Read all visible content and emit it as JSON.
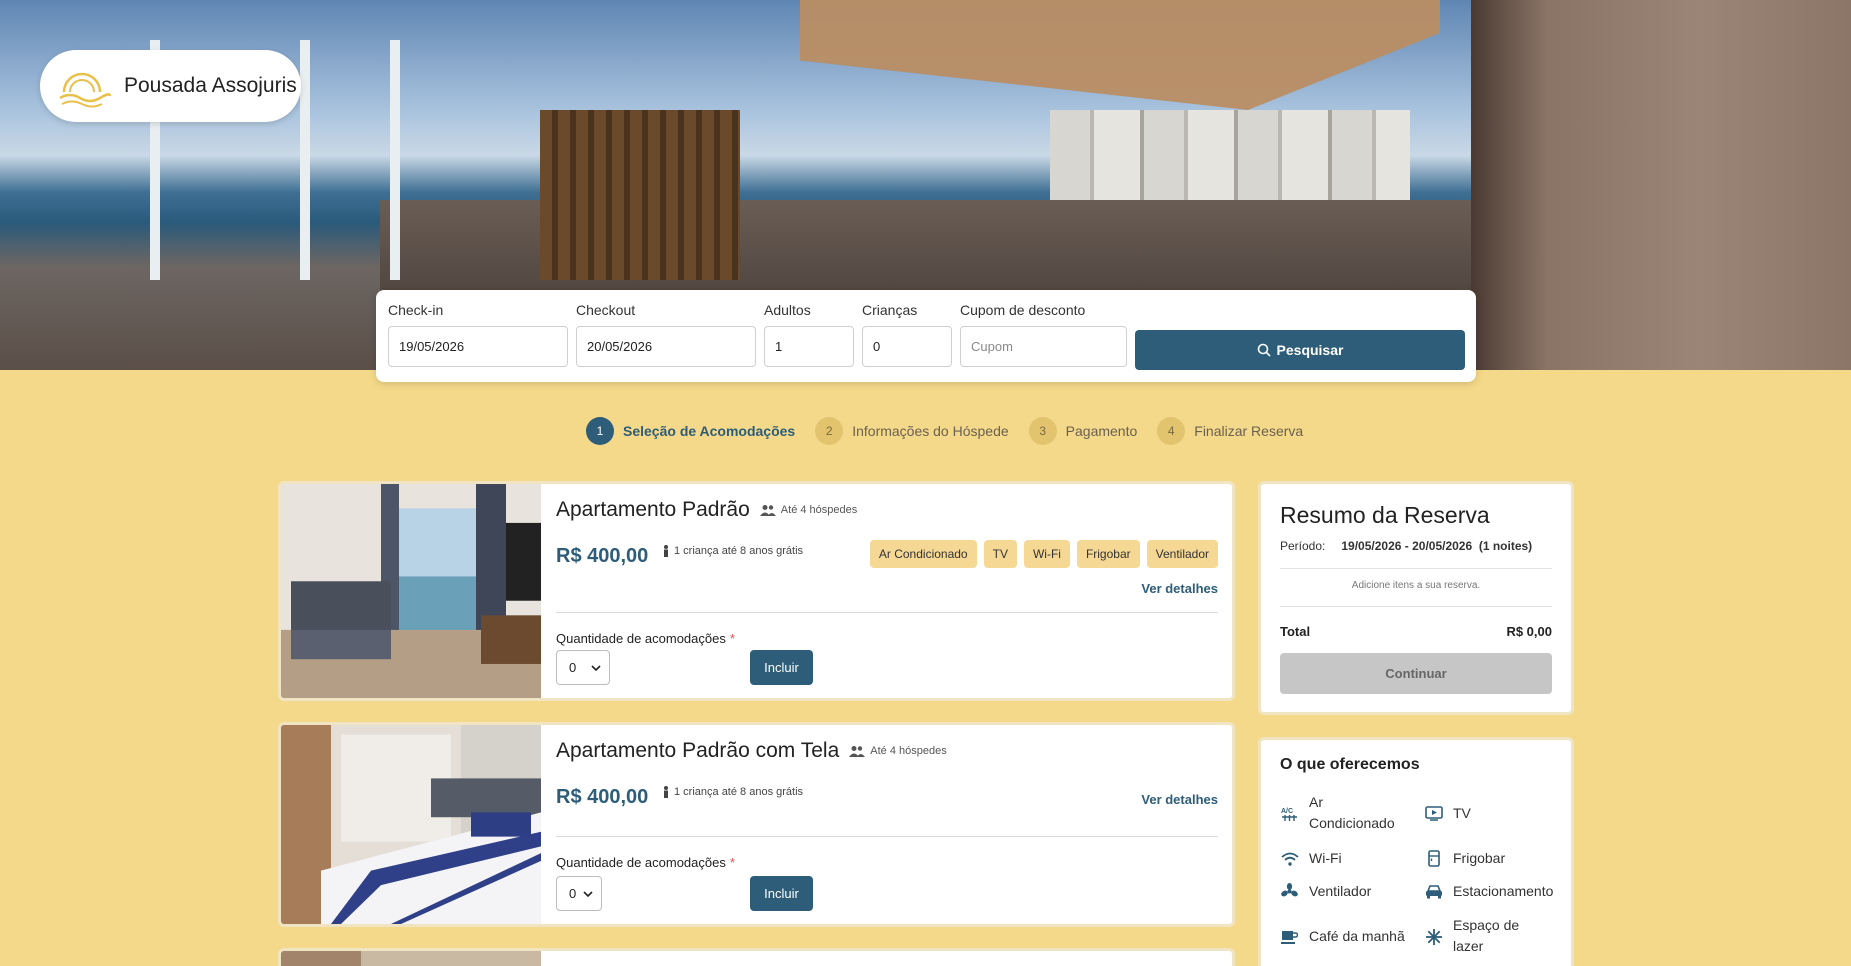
{
  "brand": {
    "name": "Pousada Assojuris"
  },
  "search": {
    "checkin_label": "Check-in",
    "checkin_value": "19/05/2026",
    "checkout_label": "Checkout",
    "checkout_value": "20/05/2026",
    "adults_label": "Adultos",
    "adults_value": "1",
    "children_label": "Crianças",
    "children_value": "0",
    "coupon_label": "Cupom de desconto",
    "coupon_placeholder": "Cupom",
    "button_label": "Pesquisar"
  },
  "steps": [
    {
      "num": "1",
      "label": "Seleção de Acomodações",
      "active": true
    },
    {
      "num": "2",
      "label": "Informações do Hóspede",
      "active": false
    },
    {
      "num": "3",
      "label": "Pagamento",
      "active": false
    },
    {
      "num": "4",
      "label": "Finalizar Reserva",
      "active": false
    }
  ],
  "rooms": [
    {
      "title": "Apartamento Padrão",
      "guests": "Até 4 hóspedes",
      "price": "R$ 400,00",
      "child_note": "1 criança até 8 anos grátis",
      "amenities": [
        "Ar Condicionado",
        "TV",
        "Wi-Fi",
        "Frigobar",
        "Ventilador"
      ],
      "details_label": "Ver detalhes",
      "qty_label": "Quantidade de acomodações",
      "required_mark": "*",
      "qty_value": "0",
      "include_label": "Incluir"
    },
    {
      "title": "Apartamento Padrão com Tela",
      "guests": "Até 4 hóspedes",
      "price": "R$ 400,00",
      "child_note": "1 criança até 8 anos grátis",
      "details_label": "Ver detalhes",
      "qty_label": "Quantidade de acomodações",
      "required_mark": "*",
      "qty_value": "0",
      "include_label": "Incluir"
    }
  ],
  "summary": {
    "title": "Resumo da Reserva",
    "period_label": "Período:",
    "period_dates": "19/05/2026 - 20/05/2026",
    "nights": "(1 noites)",
    "add_items_text": "Adicione itens a sua reserva.",
    "total_label": "Total",
    "total_value": "R$ 0,00",
    "continue_label": "Continuar"
  },
  "offers": {
    "title": "O que oferecemos",
    "items": [
      {
        "label": "Ar Condicionado",
        "icon": "ac-icon"
      },
      {
        "label": "TV",
        "icon": "tv-icon"
      },
      {
        "label": "Wi-Fi",
        "icon": "wifi-icon"
      },
      {
        "label": "Frigobar",
        "icon": "fridge-icon"
      },
      {
        "label": "Ventilador",
        "icon": "fan-icon"
      },
      {
        "label": "Estacionamento",
        "icon": "car-icon"
      },
      {
        "label": "Café da manhã",
        "icon": "coffee-icon"
      },
      {
        "label": "Espaço de lazer",
        "icon": "leisure-icon"
      }
    ]
  },
  "colors": {
    "accent": "#2d5d78",
    "background": "#f5d98a",
    "tag": "#f6d895"
  }
}
